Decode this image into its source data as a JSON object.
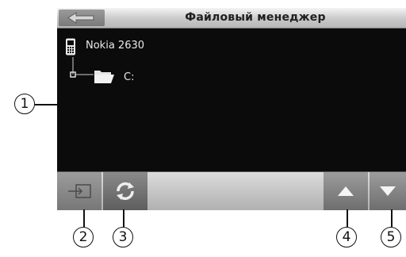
{
  "window": {
    "title": "Файловый менеджер"
  },
  "toolbar": {
    "back_icon": "back-arrow-icon",
    "exit_icon": "exit-icon",
    "refresh_icon": "refresh-icon",
    "up_icon": "up-arrow-icon",
    "down_icon": "down-arrow-icon"
  },
  "tree": {
    "device": {
      "label": "Nokia 2630",
      "icon": "phone-icon"
    },
    "drive": {
      "label": "C:",
      "icon": "folder-icon"
    }
  },
  "callouts": [
    "1",
    "2",
    "3",
    "4",
    "5"
  ]
}
